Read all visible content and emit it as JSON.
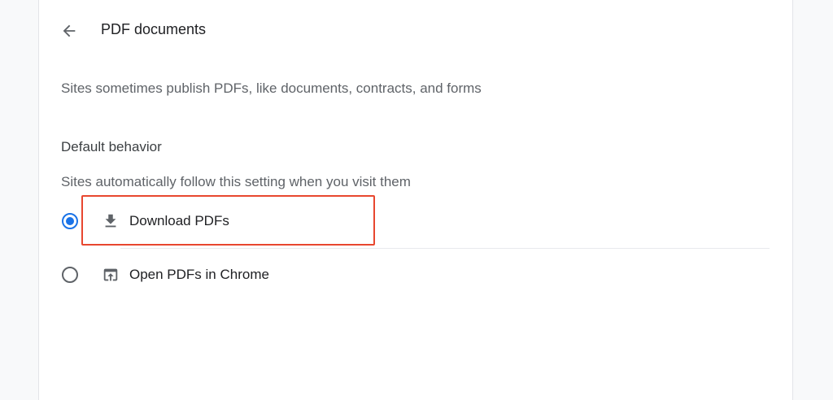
{
  "header": {
    "back_icon": "arrow-back-icon",
    "title": "PDF documents"
  },
  "description": "Sites sometimes publish PDFs, like documents, contracts, and forms",
  "default_behavior": {
    "heading": "Default behavior",
    "subtitle": "Sites automatically follow this setting when you visit them",
    "options": [
      {
        "label": "Download PDFs",
        "icon": "download-icon",
        "selected": true
      },
      {
        "label": "Open PDFs in Chrome",
        "icon": "open-in-browser-icon",
        "selected": false
      }
    ]
  },
  "colors": {
    "accent": "#1a73e8",
    "highlight": "#e8472f"
  }
}
